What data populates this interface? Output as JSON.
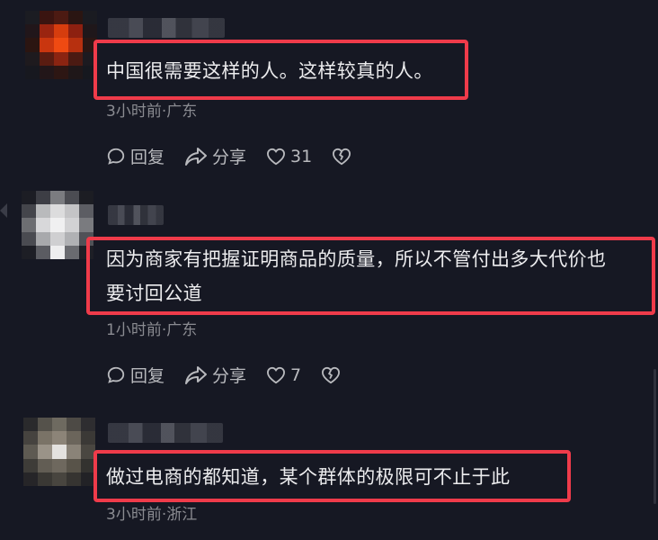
{
  "colors": {
    "background": "#161823",
    "highlight_border": "#ef3b4a",
    "text": "#ececee",
    "meta_text": "#8a8b91",
    "action_text": "#b8b9bd"
  },
  "comments": [
    {
      "text_lines": [
        "中国很需要这样的人。这样较真的人。"
      ],
      "meta": "3小时前·广东",
      "reply_label": "回复",
      "share_label": "分享",
      "like_count": "31",
      "icons": [
        "reply-icon",
        "share-icon",
        "heart-icon",
        "broken-heart-icon"
      ]
    },
    {
      "text_lines": [
        "因为商家有把握证明商品的质量，所以不管付出多大代价也",
        "要讨回公道"
      ],
      "meta": "1小时前·广东",
      "reply_label": "回复",
      "share_label": "分享",
      "like_count": "7",
      "icons": [
        "reply-icon",
        "share-icon",
        "heart-icon",
        "broken-heart-icon"
      ]
    },
    {
      "text_lines": [
        "做过电商的都知道，某个群体的极限可不止于此"
      ],
      "meta": "3小时前·浙江"
    }
  ]
}
